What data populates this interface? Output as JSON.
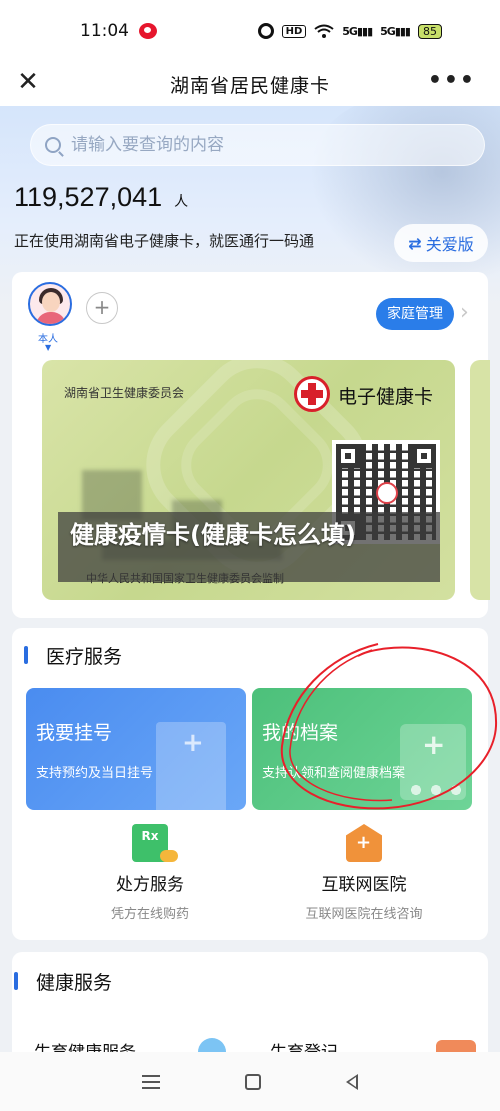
{
  "status_bar": {
    "time": "11:04",
    "hd": "HD",
    "signal_1": "5G",
    "signal_2": "5G",
    "battery": "85",
    "icons": [
      "weibo-icon",
      "alarm-icon",
      "wifi-icon",
      "signal-icon",
      "battery-icon"
    ]
  },
  "nav": {
    "title": "湖南省居民健康卡",
    "close_icon": "close-icon",
    "more_icon": "more-icon"
  },
  "header": {
    "search_placeholder": "请输入要查询的内容",
    "user_count": "119,527,041",
    "user_unit": "人",
    "description": "正在使用湖南省电子健康卡，就医通行一码通",
    "care_button_label": "关爱版"
  },
  "card_panel": {
    "avatar_label": "本人",
    "family_button_label": "家庭管理",
    "card": {
      "issuer": "湖南省卫生健康委员会",
      "type_label": "电子健康卡",
      "footer": "中华人民共和国国家卫生健康委员会监制"
    },
    "overlay_text": "健康疫情卡(健康卡怎么填)"
  },
  "medical": {
    "title": "医疗服务",
    "tiles": [
      {
        "title": "我要挂号",
        "subtitle": "支持预约及当日挂号"
      },
      {
        "title": "我的档案",
        "subtitle": "支持认领和查阅健康档案"
      }
    ],
    "services": [
      {
        "title": "处方服务",
        "subtitle": "凭方在线购药",
        "icon": "prescription-icon"
      },
      {
        "title": "互联网医院",
        "subtitle": "互联网医院在线咨询",
        "icon": "hospital-icon"
      }
    ]
  },
  "health": {
    "title": "健康服务",
    "items": [
      "生育健康服务",
      "生育登记"
    ]
  },
  "colors": {
    "primary": "#2a6de0",
    "tile_blue": "#4a8cf0",
    "tile_green": "#4cc07a",
    "annotation_red": "#e8202a"
  }
}
